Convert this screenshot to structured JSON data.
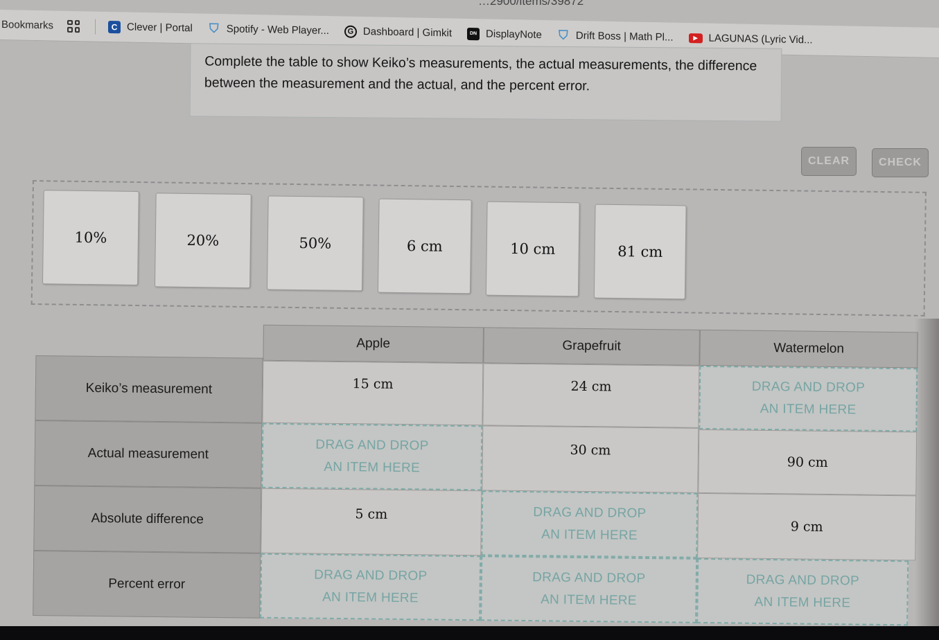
{
  "browser": {
    "url_fragment": "…2900/items/39872",
    "bookmarks_label": "Bookmarks",
    "bookmarks": [
      {
        "label": "Clever | Portal",
        "icon": "clever-icon",
        "glyph": "C"
      },
      {
        "label": "Spotify - Web Player...",
        "icon": "shield-logo-icon",
        "glyph": "⛉"
      },
      {
        "label": "Dashboard | Gimkit",
        "icon": "gimkit-icon",
        "glyph": "G"
      },
      {
        "label": "DisplayNote",
        "icon": "displaynote-icon",
        "glyph": "DN"
      },
      {
        "label": "Drift Boss | Math Pl...",
        "icon": "shield-logo-icon",
        "glyph": "⛉"
      },
      {
        "label": "LAGUNAS (Lyric Vid...",
        "icon": "youtube-icon",
        "glyph": "▶"
      }
    ]
  },
  "question": {
    "instructions": "Complete the table to show Keiko’s measurements, the actual measurements, the difference between the measurement and the actual, and the percent error."
  },
  "buttons": {
    "clear": "CLEAR",
    "check": "CHECK"
  },
  "tiles": [
    "10%",
    "20%",
    "50%",
    "6 cm",
    "10 cm",
    "81 cm"
  ],
  "table": {
    "columns": [
      "Apple",
      "Grapefruit",
      "Watermelon"
    ],
    "drop_placeholder_line1": "DRAG AND DROP",
    "drop_placeholder_line2": "AN ITEM HERE",
    "rows": [
      {
        "label": "Keiko’s measurement",
        "cells": [
          {
            "value": "15 cm"
          },
          {
            "value": "24 cm"
          },
          {
            "drop": true
          }
        ]
      },
      {
        "label": "Actual measurement",
        "cells": [
          {
            "drop": true
          },
          {
            "value": "30 cm"
          },
          {
            "value": "90 cm"
          }
        ]
      },
      {
        "label": "Absolute difference",
        "cells": [
          {
            "value": "5 cm"
          },
          {
            "drop": true
          },
          {
            "value": "9 cm"
          }
        ]
      },
      {
        "label": "Percent error",
        "cells": [
          {
            "drop": true
          },
          {
            "drop": true
          },
          {
            "drop": true
          }
        ]
      }
    ]
  },
  "colors": {
    "drop_accent": "#76a4a4"
  }
}
